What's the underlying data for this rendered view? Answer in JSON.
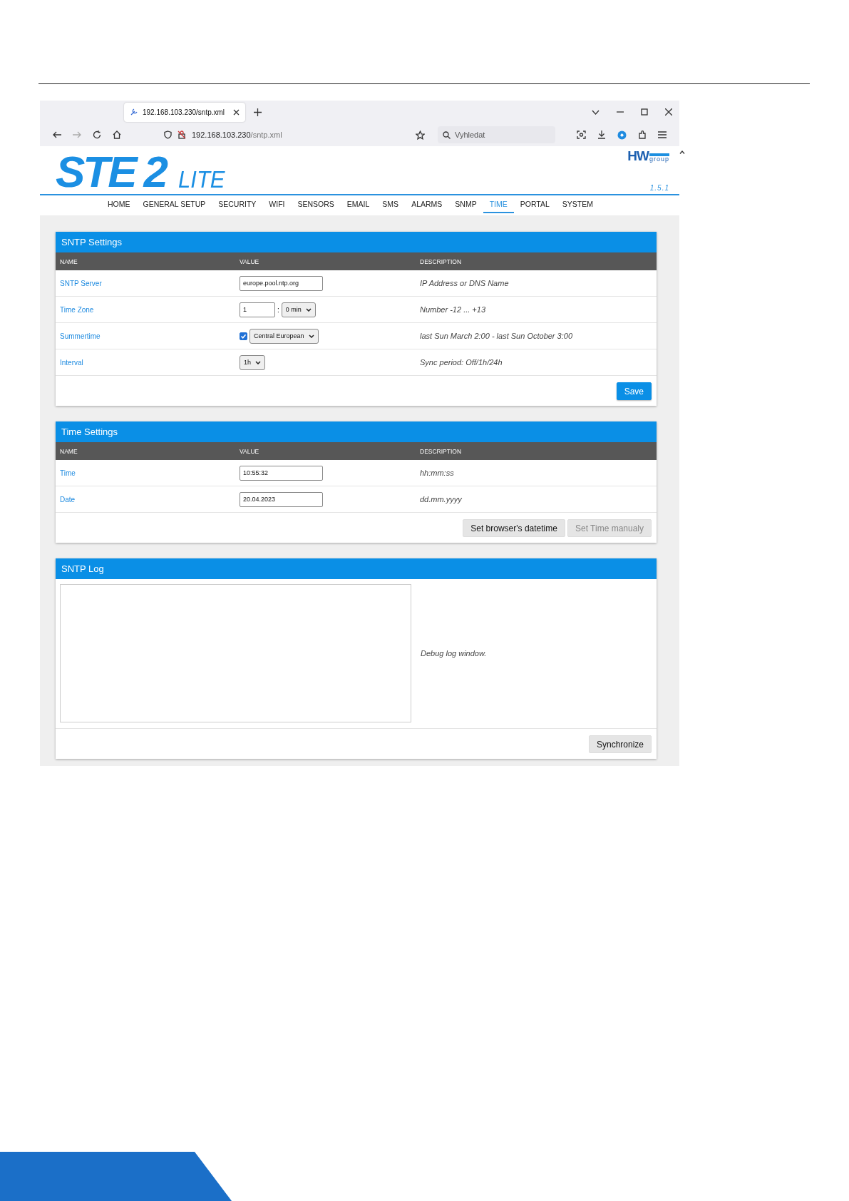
{
  "browser": {
    "tab_title": "192.168.103.230/sntp.xml",
    "url_host": "192.168.103.230",
    "url_path": "/sntp.xml",
    "search": {
      "placeholder": "Vyhledat"
    }
  },
  "header": {
    "logo_main": "STE",
    "logo_num": "2",
    "logo_sub": "LITE",
    "brand_main": "HW",
    "brand_sub": "group",
    "version": "1.5.1"
  },
  "menu": [
    {
      "label": "HOME",
      "selected": false
    },
    {
      "label": "GENERAL SETUP",
      "selected": false
    },
    {
      "label": "SECURITY",
      "selected": false
    },
    {
      "label": "WIFI",
      "selected": false
    },
    {
      "label": "SENSORS",
      "selected": false
    },
    {
      "label": "EMAIL",
      "selected": false
    },
    {
      "label": "SMS",
      "selected": false
    },
    {
      "label": "ALARMS",
      "selected": false
    },
    {
      "label": "SNMP",
      "selected": false
    },
    {
      "label": "TIME",
      "selected": true
    },
    {
      "label": "PORTAL",
      "selected": false
    },
    {
      "label": "SYSTEM",
      "selected": false
    }
  ],
  "panels": [
    {
      "title": "SNTP Settings",
      "columns": [
        "NAME",
        "VALUE",
        "DESCRIPTION"
      ],
      "rows": [
        {
          "kind": "text",
          "name": "SNTP Server",
          "value": "europe.pool.ntp.org",
          "description": "IP Address or DNS Name"
        },
        {
          "kind": "number_select",
          "name": "Time Zone",
          "value": "1",
          "separator": ":",
          "minutes": "0 min",
          "description": "Number -12 ... +13"
        },
        {
          "kind": "check_select",
          "name": "Summertime",
          "checked": true,
          "region": "Central European",
          "description": "last Sun March 2:00 - last Sun October 3:00"
        },
        {
          "kind": "select",
          "name": "Interval",
          "select": "1h",
          "description": "Sync period: Off/1h/24h"
        }
      ],
      "buttons": [
        {
          "label": "Save",
          "kind": "primary",
          "disabled": false
        }
      ]
    },
    {
      "title": "Time Settings",
      "columns": [
        "NAME",
        "VALUE",
        "DESCRIPTION"
      ],
      "rows": [
        {
          "kind": "text",
          "name": "Time",
          "value": "10:55:32",
          "description": "hh:mm:ss"
        },
        {
          "kind": "text",
          "name": "Date",
          "value": "20.04.2023",
          "description": "dd.mm.yyyy"
        }
      ],
      "buttons": [
        {
          "label": "Set browser's datetime",
          "kind": "default",
          "disabled": false
        },
        {
          "label": "Set Time manualy",
          "kind": "default",
          "disabled": true
        }
      ]
    },
    {
      "title": "SNTP Log",
      "log": {
        "description": "Debug log window."
      },
      "buttons": [
        {
          "label": "Synchronize",
          "kind": "default",
          "disabled": false
        }
      ]
    }
  ]
}
